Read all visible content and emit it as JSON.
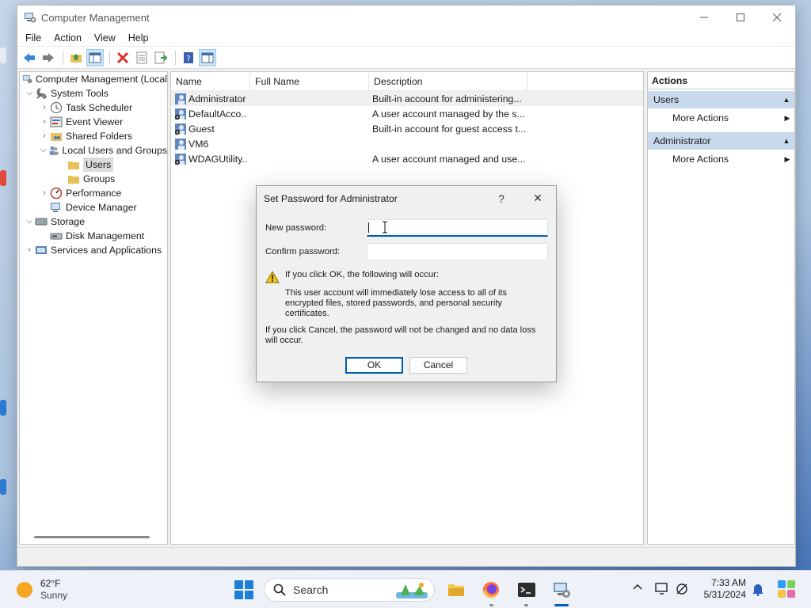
{
  "window": {
    "title": "Computer Management"
  },
  "menu": [
    "File",
    "Action",
    "View",
    "Help"
  ],
  "tree": {
    "root": "Computer Management (Local",
    "system_tools": "System Tools",
    "task_scheduler": "Task Scheduler",
    "event_viewer": "Event Viewer",
    "shared_folders": "Shared Folders",
    "local_users_groups": "Local Users and Groups",
    "users": "Users",
    "groups": "Groups",
    "performance": "Performance",
    "device_manager": "Device Manager",
    "storage": "Storage",
    "disk_management": "Disk Management",
    "services_apps": "Services and Applications"
  },
  "list": {
    "columns": [
      "Name",
      "Full Name",
      "Description"
    ],
    "rows": [
      {
        "name": "Administrator",
        "full_name": "",
        "description": "Built-in account for administering..."
      },
      {
        "name": "DefaultAcco...",
        "full_name": "",
        "description": "A user account managed by the s..."
      },
      {
        "name": "Guest",
        "full_name": "",
        "description": "Built-in account for guest access t..."
      },
      {
        "name": "VM6",
        "full_name": "",
        "description": ""
      },
      {
        "name": "WDAGUtility...",
        "full_name": "",
        "description": "A user account managed and use..."
      }
    ]
  },
  "actions": {
    "header": "Actions",
    "sections": [
      {
        "title": "Users",
        "item": "More Actions"
      },
      {
        "title": "Administrator",
        "item": "More Actions"
      }
    ]
  },
  "dialog": {
    "title": "Set Password for Administrator",
    "help": "?",
    "close": "✕",
    "new_password_label": "New password:",
    "new_password_value": "",
    "confirm_password_label": "Confirm password:",
    "confirm_password_value": "",
    "warning_heading": "If you click OK, the following will occur:",
    "warning_body": "This user account will immediately lose access to all of its encrypted files, stored passwords, and personal security certificates.",
    "cancel_note": "If you click Cancel, the password will not be changed and no data loss will occur.",
    "ok_label": "OK",
    "cancel_label": "Cancel"
  },
  "taskbar": {
    "temperature": "62°F",
    "condition": "Sunny",
    "search_label": "Search",
    "time": "7:33 AM",
    "date": "5/31/2024"
  },
  "colors": {
    "accent": "#005fb8",
    "selection": "#cce4f7",
    "action_section": "#c9d9ec"
  }
}
